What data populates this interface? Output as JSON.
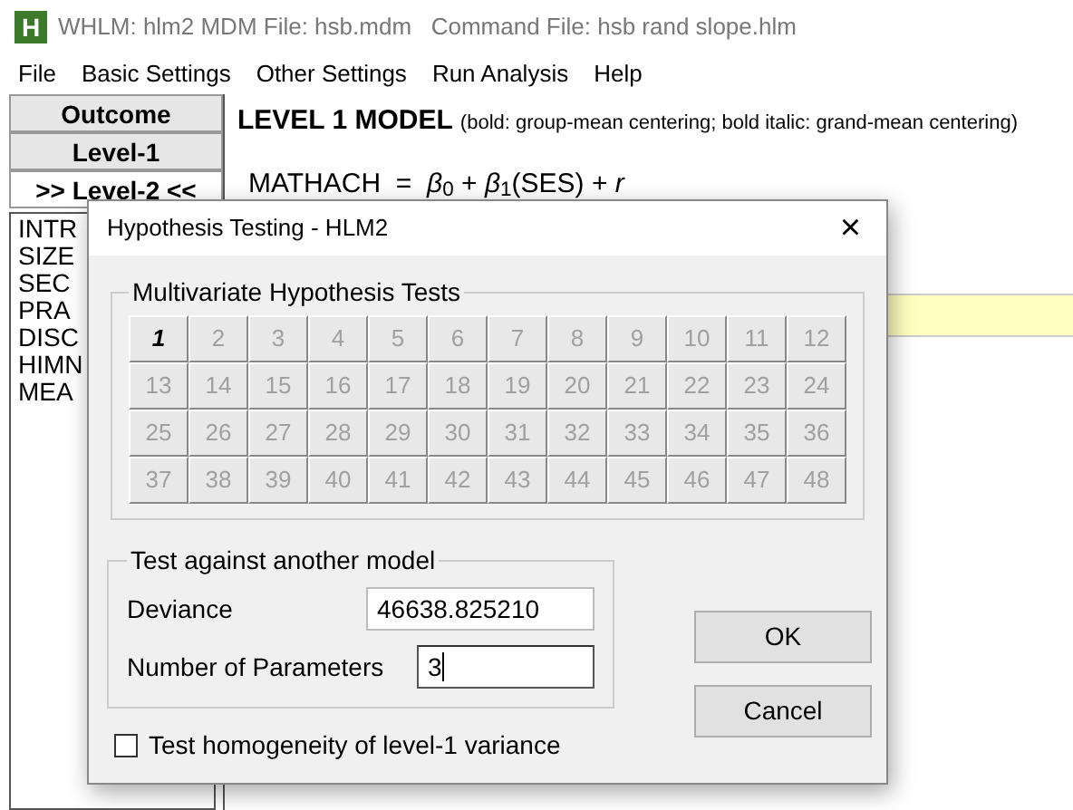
{
  "window": {
    "title": "WHLM: hlm2 MDM File: hsb.mdm   Command File: hsb rand slope.hlm",
    "icon_letter": "H"
  },
  "menu": [
    "File",
    "Basic Settings",
    "Other Settings",
    "Run Analysis",
    "Help"
  ],
  "side_buttons": [
    {
      "label": "Outcome",
      "selected": false
    },
    {
      "label": "Level-1",
      "selected": false
    },
    {
      "label": ">> Level-2 <<",
      "selected": true
    }
  ],
  "variables": [
    "INTR",
    "SIZE",
    "SEC",
    "PRA",
    "DISC",
    "HIMN",
    "MEA"
  ],
  "model": {
    "heading": "LEVEL 1 MODEL",
    "note": "(bold: group-mean centering; bold italic: grand-mean centering)",
    "equation": "MATHACH  =  *β*$_{0}$ + *β*$_{1}$(SES) + *r*"
  },
  "dialog": {
    "title": "Hypothesis Testing - HLM2",
    "close": "×",
    "multivariate": {
      "title": "Multivariate Hypothesis Tests",
      "buttons": [
        {
          "label": "1",
          "disabled": false
        },
        {
          "label": "2",
          "disabled": true
        },
        {
          "label": "3",
          "disabled": true
        },
        {
          "label": "4",
          "disabled": true
        },
        {
          "label": "5",
          "disabled": true
        },
        {
          "label": "6",
          "disabled": true
        },
        {
          "label": "7",
          "disabled": true
        },
        {
          "label": "8",
          "disabled": true
        },
        {
          "label": "9",
          "disabled": true
        },
        {
          "label": "10",
          "disabled": true
        },
        {
          "label": "11",
          "disabled": true
        },
        {
          "label": "12",
          "disabled": true
        },
        {
          "label": "13",
          "disabled": true
        },
        {
          "label": "14",
          "disabled": true
        },
        {
          "label": "15",
          "disabled": true
        },
        {
          "label": "16",
          "disabled": true
        },
        {
          "label": "17",
          "disabled": true
        },
        {
          "label": "18",
          "disabled": true
        },
        {
          "label": "19",
          "disabled": true
        },
        {
          "label": "20",
          "disabled": true
        },
        {
          "label": "21",
          "disabled": true
        },
        {
          "label": "22",
          "disabled": true
        },
        {
          "label": "23",
          "disabled": true
        },
        {
          "label": "24",
          "disabled": true
        },
        {
          "label": "25",
          "disabled": true
        },
        {
          "label": "26",
          "disabled": true
        },
        {
          "label": "27",
          "disabled": true
        },
        {
          "label": "28",
          "disabled": true
        },
        {
          "label": "29",
          "disabled": true
        },
        {
          "label": "30",
          "disabled": true
        },
        {
          "label": "31",
          "disabled": true
        },
        {
          "label": "32",
          "disabled": true
        },
        {
          "label": "33",
          "disabled": true
        },
        {
          "label": "34",
          "disabled": true
        },
        {
          "label": "35",
          "disabled": true
        },
        {
          "label": "36",
          "disabled": true
        },
        {
          "label": "37",
          "disabled": true
        },
        {
          "label": "38",
          "disabled": true
        },
        {
          "label": "39",
          "disabled": true
        },
        {
          "label": "40",
          "disabled": true
        },
        {
          "label": "41",
          "disabled": true
        },
        {
          "label": "42",
          "disabled": true
        },
        {
          "label": "43",
          "disabled": true
        },
        {
          "label": "44",
          "disabled": true
        },
        {
          "label": "45",
          "disabled": true
        },
        {
          "label": "46",
          "disabled": true
        },
        {
          "label": "47",
          "disabled": true
        },
        {
          "label": "48",
          "disabled": true
        }
      ]
    },
    "test_model": {
      "title": "Test against another model",
      "fields": [
        {
          "label": "Deviance",
          "value": "46638.825210",
          "focused": false
        },
        {
          "label": "Number of Parameters",
          "value": "3",
          "focused": true
        }
      ]
    },
    "checkbox": {
      "label": "Test homogeneity of level-1 variance",
      "checked": false
    },
    "buttons": [
      "OK",
      "Cancel"
    ]
  }
}
